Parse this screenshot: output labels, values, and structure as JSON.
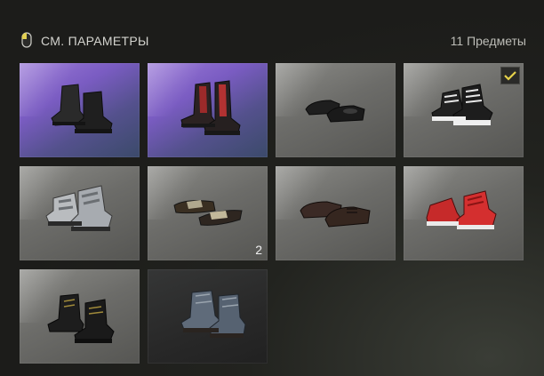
{
  "header": {
    "title": "СМ. ПАРАМЕТРЫ",
    "count": "11 Предметы"
  },
  "colors": {
    "accent": "#e6d24a",
    "purple_tier": "#7a5cc2",
    "standard_tier": "#6c6c69"
  },
  "items": [
    {
      "name": "black-combat-boots",
      "icon": "boots-icon"
    },
    {
      "name": "black-red-laced-boots",
      "icon": "boots-icon"
    },
    {
      "name": "black-slip-on-shoes",
      "icon": "shoes-icon",
      "quantity": ""
    },
    {
      "name": "black-white-sneakers",
      "icon": "sneakers-icon",
      "equipped": true
    },
    {
      "name": "white-camo-sneakers",
      "icon": "sneakers-icon"
    },
    {
      "name": "sandals",
      "icon": "sandals-icon",
      "quantity": "2"
    },
    {
      "name": "brown-dress-shoes",
      "icon": "shoes-icon"
    },
    {
      "name": "red-sneakers",
      "icon": "sneakers-icon"
    },
    {
      "name": "black-work-boots",
      "icon": "boots-icon"
    },
    {
      "name": "blue-worn-boots",
      "icon": "boots-icon"
    }
  ]
}
